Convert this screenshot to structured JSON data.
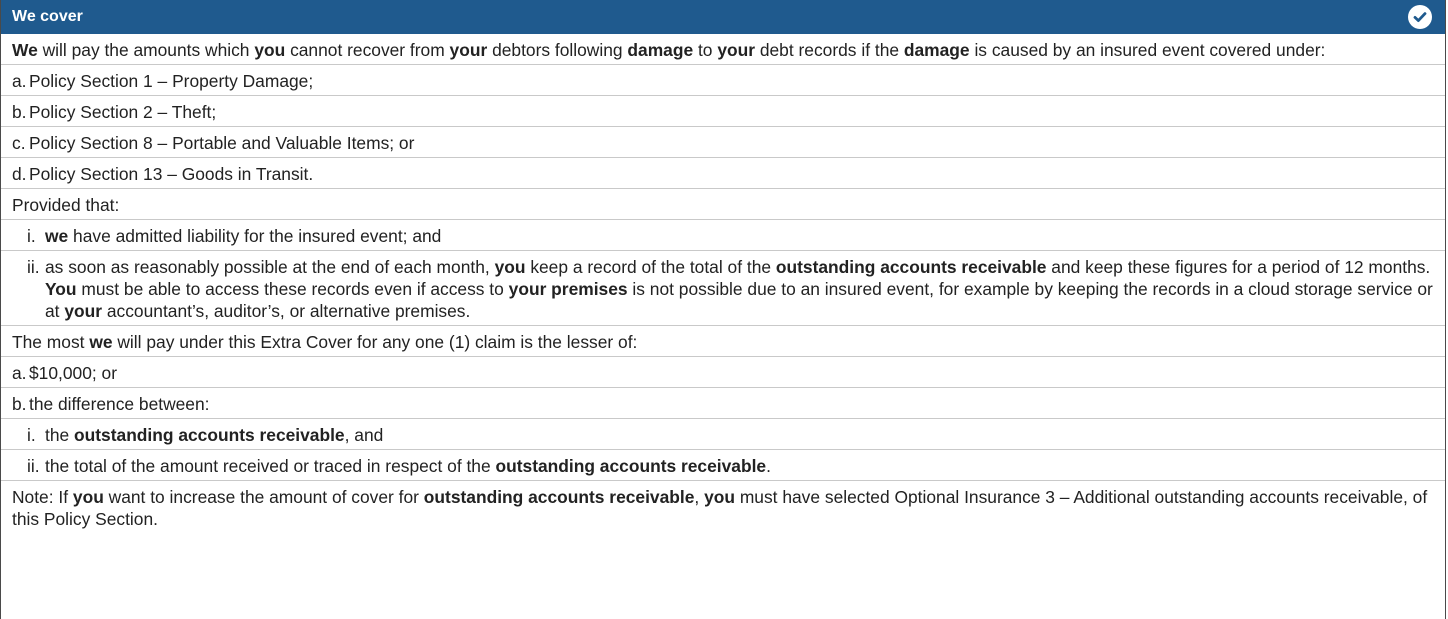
{
  "header": {
    "title": "We cover",
    "icon": "check-circle-icon",
    "color": "#1f5a8e"
  },
  "rows": [
    {
      "id": "intro",
      "parts": [
        "We",
        " will pay the amounts which ",
        "you",
        " cannot recover from ",
        "your",
        " debtors following ",
        "damage",
        " to ",
        "your",
        " debt records if the ",
        "damage",
        " is caused by an insured event covered under:"
      ]
    },
    {
      "id": "a",
      "marker": "a.",
      "text": "Policy Section 1 – Property Damage;"
    },
    {
      "id": "b",
      "marker": "b.",
      "text": "Policy Section 2 – Theft;"
    },
    {
      "id": "c",
      "marker": "c.",
      "text": "Policy Section 8 – Portable and Valuable Items; or"
    },
    {
      "id": "d",
      "marker": "d.",
      "text": "Policy Section 13 – Goods in Transit."
    },
    {
      "id": "provided",
      "text": "Provided that:"
    },
    {
      "id": "i",
      "marker": "i.",
      "parts": [
        "we",
        " have admitted liability for the insured event; and"
      ]
    },
    {
      "id": "ii",
      "marker": "ii.",
      "parts": [
        "as soon as reasonably possible at the end of each month, ",
        "you",
        " keep a record of the total of the ",
        "outstanding accounts receivable",
        " and keep these figures for a period of 12 months. ",
        "You",
        " must be able to access these records even if access to ",
        "your premises",
        " is not possible due to an insured event, for example by keeping the records in a cloud storage service or at ",
        "your",
        " accountant’s, auditor’s, or alternative premises."
      ]
    },
    {
      "id": "most",
      "parts": [
        "The most ",
        "we",
        " will pay under this Extra Cover for any one (1) claim is the lesser of:"
      ]
    },
    {
      "id": "a2",
      "marker": "a.",
      "text": "$10,000; or"
    },
    {
      "id": "b2",
      "marker": "b.",
      "text": "the difference between:"
    },
    {
      "id": "i2",
      "marker": "i.",
      "parts": [
        "the ",
        "outstanding accounts receivable",
        ", and"
      ]
    },
    {
      "id": "ii2",
      "marker": "ii.",
      "parts": [
        "the total of the amount received or traced in respect of the ",
        "outstanding accounts receivable",
        "."
      ]
    },
    {
      "id": "note",
      "parts": [
        "Note: If ",
        "you",
        " want to increase the amount of cover for ",
        "outstanding accounts receivable",
        ", ",
        "you",
        " must have selected Optional Insurance 3 – Additional outstanding accounts receivable, of this Policy Section."
      ]
    }
  ]
}
